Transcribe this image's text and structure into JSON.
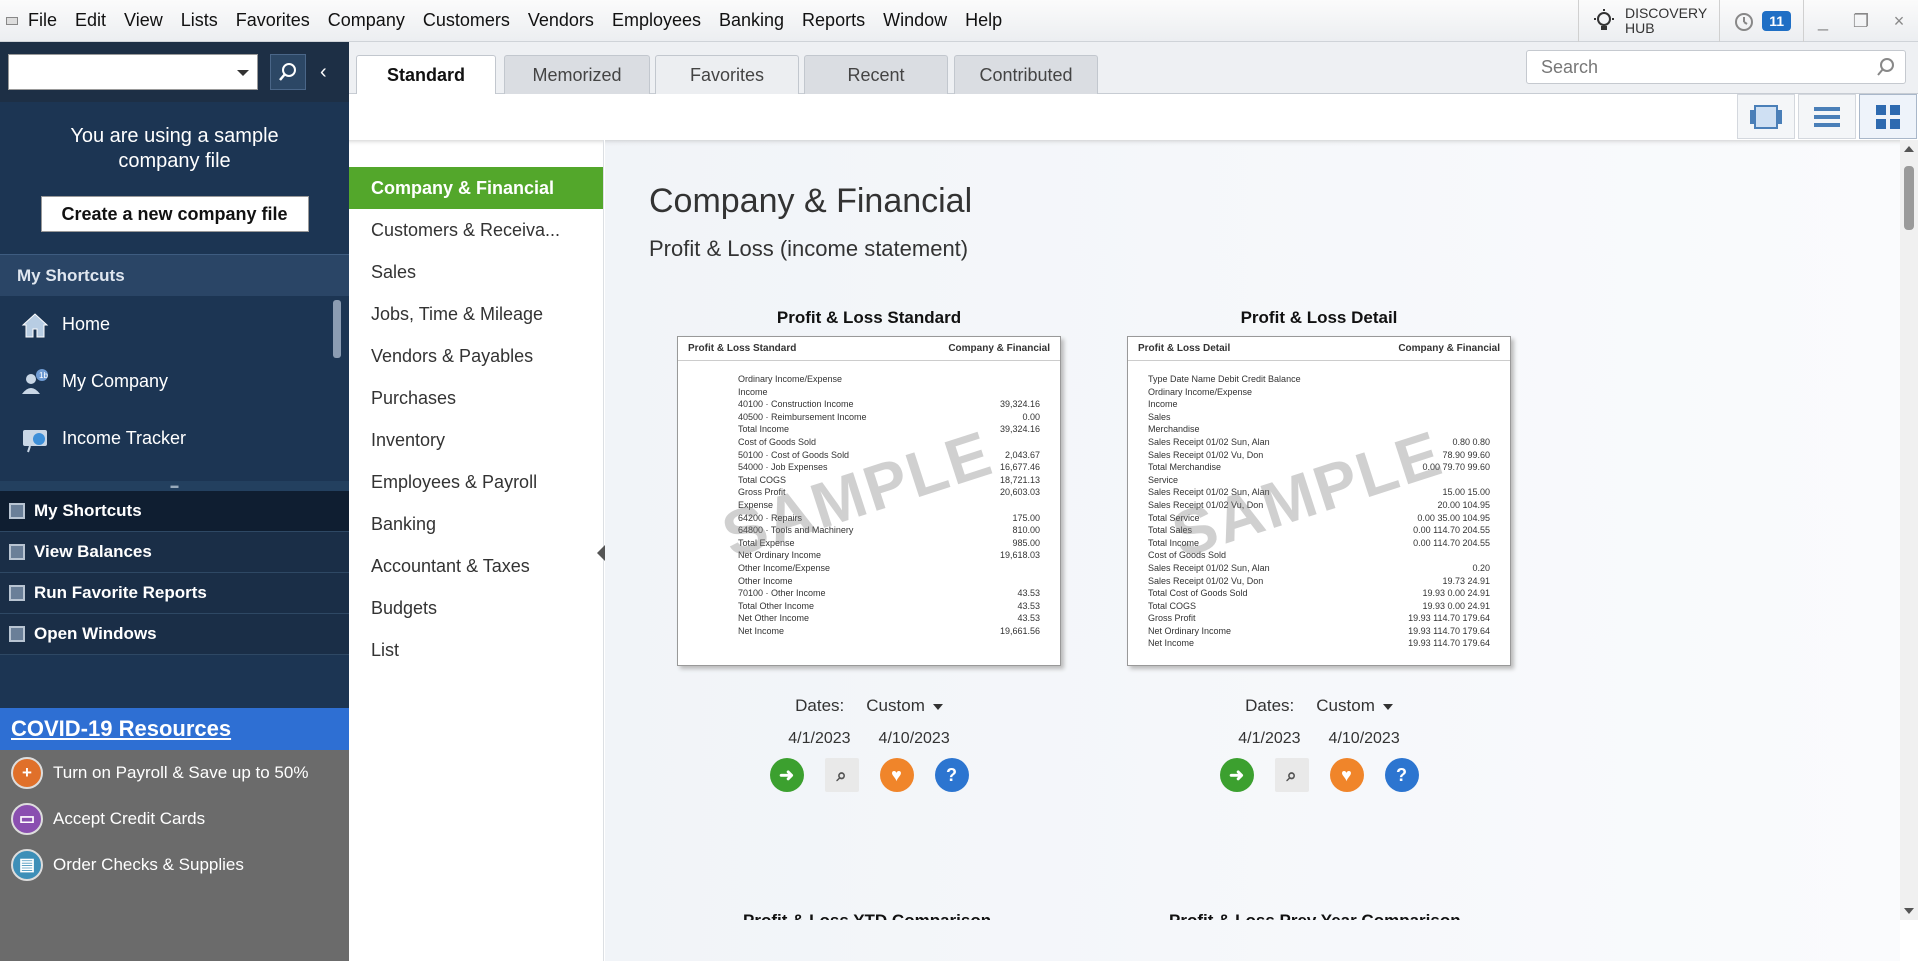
{
  "menu": [
    "File",
    "Edit",
    "View",
    "Lists",
    "Favorites",
    "Company",
    "Customers",
    "Vendors",
    "Employees",
    "Banking",
    "Reports",
    "Window",
    "Help"
  ],
  "discovery_hub": {
    "line1": "DISCOVERY",
    "line2": "HUB"
  },
  "alerts_count": "11",
  "left": {
    "sample_message": "You are using a sample company file",
    "create_button": "Create a new company file",
    "shortcuts_header": "My Shortcuts",
    "shortcuts": [
      {
        "label": "Home",
        "icon": "home-icon"
      },
      {
        "label": "My Company",
        "icon": "my-company-icon"
      },
      {
        "label": "Income Tracker",
        "icon": "income-tracker-icon"
      }
    ],
    "nav": [
      {
        "label": "My Shortcuts"
      },
      {
        "label": "View Balances"
      },
      {
        "label": "Run Favorite Reports"
      },
      {
        "label": "Open Windows"
      }
    ],
    "covid_title": "COVID-19 Resources",
    "resources": [
      {
        "label": "Turn on Payroll & Save up to 50%",
        "color": "#e0702a"
      },
      {
        "label": "Accept Credit Cards",
        "color": "#8a4fb0"
      },
      {
        "label": "Order Checks & Supplies",
        "color": "#3d8fb8"
      }
    ]
  },
  "tabs": [
    "Standard",
    "Memorized",
    "Favorites",
    "Recent",
    "Contributed"
  ],
  "search_placeholder": "Search",
  "categories": [
    "Company & Financial",
    "Customers & Receiva...",
    "Sales",
    "Jobs, Time & Mileage",
    "Vendors & Payables",
    "Purchases",
    "Inventory",
    "Employees & Payroll",
    "Banking",
    "Accountant & Taxes",
    "Budgets",
    "List"
  ],
  "main": {
    "title": "Company & Financial",
    "section": "Profit & Loss (income statement)",
    "cards": [
      {
        "title": "Profit & Loss Standard",
        "thumb_left": "Profit & Loss Standard",
        "thumb_right": "Company & Financial",
        "watermark": "SAMPLE",
        "dates_label": "Dates:",
        "dates_value": "Custom",
        "from": "4/1/2023",
        "to": "4/10/2023"
      },
      {
        "title": "Profit & Loss Detail",
        "thumb_left": "Profit & Loss Detail",
        "thumb_right": "Company & Financial",
        "watermark": "SAMPLE",
        "dates_label": "Dates:",
        "dates_value": "Custom",
        "from": "4/1/2023",
        "to": "4/10/2023"
      }
    ],
    "next_titles": [
      "Profit & Loss YTD Comparison",
      "Profit & Loss Prev Year Comparison"
    ],
    "pl_standard_lines": [
      [
        "Ordinary Income/Expense",
        ""
      ],
      [
        "Income",
        ""
      ],
      [
        "40100 · Construction Income",
        "39,324.16"
      ],
      [
        "40500 · Reimbursement Income",
        "0.00"
      ],
      [
        "Total Income",
        "39,324.16"
      ],
      [
        "Cost of Goods Sold",
        ""
      ],
      [
        "50100 · Cost of Goods Sold",
        "2,043.67"
      ],
      [
        "54000 · Job Expenses",
        "16,677.46"
      ],
      [
        "Total COGS",
        "18,721.13"
      ],
      [
        "Gross Profit",
        "20,603.03"
      ],
      [
        "Expense",
        ""
      ],
      [
        "64200 · Repairs",
        "175.00"
      ],
      [
        "64800 · Tools and Machinery",
        "810.00"
      ],
      [
        "Total Expense",
        "985.00"
      ],
      [
        "Net Ordinary Income",
        "19,618.03"
      ],
      [
        "Other Income/Expense",
        ""
      ],
      [
        "Other Income",
        ""
      ],
      [
        "70100 · Other Income",
        "43.53"
      ],
      [
        "Total Other Income",
        "43.53"
      ],
      [
        "Net Other Income",
        "43.53"
      ],
      [
        "Net Income",
        "19,661.56"
      ]
    ],
    "pl_detail_lines": [
      [
        "Type  Date  Name  Debit  Credit  Balance",
        ""
      ],
      [
        "Ordinary Income/Expense",
        ""
      ],
      [
        "Income",
        ""
      ],
      [
        "Sales",
        ""
      ],
      [
        "Merchandise",
        ""
      ],
      [
        "Sales Receipt 01/02 Sun, Alan",
        "0.80  0.80"
      ],
      [
        "Sales Receipt 01/02 Vu, Don",
        "78.90  99.60"
      ],
      [
        "Total Merchandise",
        "0.00  79.70  99.60"
      ],
      [
        "Service",
        ""
      ],
      [
        "Sales Receipt 01/02 Sun, Alan",
        "15.00  15.00"
      ],
      [
        "Sales Receipt 01/02 Vu, Don",
        "20.00  104.95"
      ],
      [
        "Total Service",
        "0.00  35.00  104.95"
      ],
      [
        "Total Sales",
        "0.00  114.70  204.55"
      ],
      [
        "Total Income",
        "0.00  114.70  204.55"
      ],
      [
        "Cost of Goods Sold",
        ""
      ],
      [
        "Sales Receipt 01/02 Sun, Alan",
        "0.20"
      ],
      [
        "Sales Receipt 01/02 Vu, Don",
        "19.73  24.91"
      ],
      [
        "Total Cost of Goods Sold",
        "19.93  0.00  24.91"
      ],
      [
        "Total COGS",
        "19.93  0.00  24.91"
      ],
      [
        "Gross Profit",
        "19.93  114.70  179.64"
      ],
      [
        "Net Ordinary Income",
        "19.93  114.70  179.64"
      ],
      [
        "Net Income",
        "19.93  114.70  179.64"
      ]
    ]
  }
}
